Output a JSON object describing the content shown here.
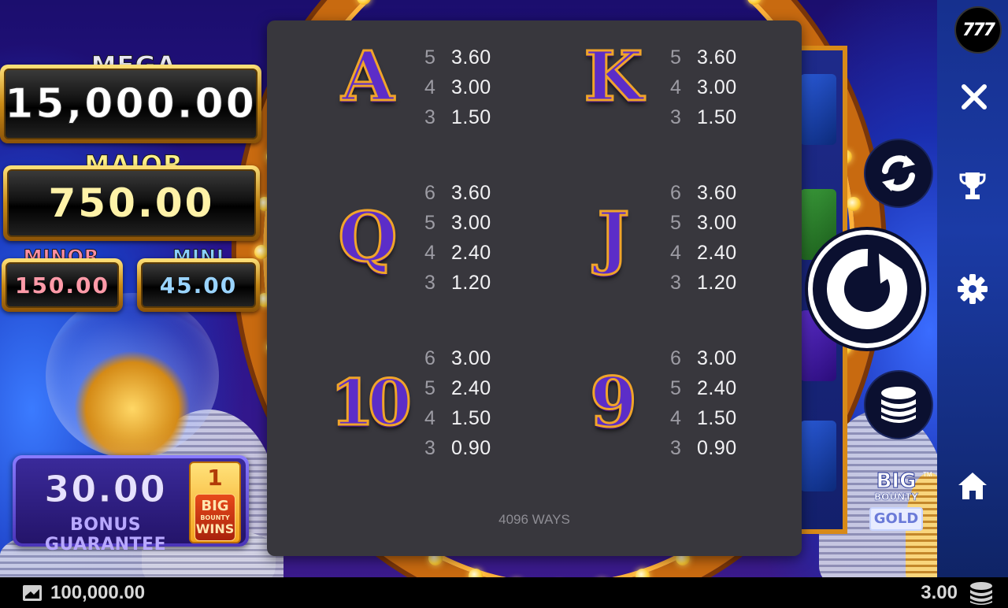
{
  "jackpots": {
    "mega": {
      "label": "MEGA",
      "value": "15,000.00"
    },
    "major": {
      "label": "MAJOR",
      "value": "750.00"
    },
    "minor": {
      "label": "MINOR",
      "value": "150.00"
    },
    "mini": {
      "label": "MINI",
      "value": "45.00"
    }
  },
  "bonus_guarantee": {
    "value": "30.00",
    "label": "BONUS GUARANTEE",
    "badge_count": "1",
    "badge_logo": [
      "BIG",
      "BOUNTY",
      "WINS"
    ]
  },
  "paytable": {
    "symbols": [
      {
        "glyph": "A",
        "pays": [
          {
            "count": "5",
            "value": "3.60"
          },
          {
            "count": "4",
            "value": "3.00"
          },
          {
            "count": "3",
            "value": "1.50"
          }
        ]
      },
      {
        "glyph": "K",
        "pays": [
          {
            "count": "5",
            "value": "3.60"
          },
          {
            "count": "4",
            "value": "3.00"
          },
          {
            "count": "3",
            "value": "1.50"
          }
        ]
      },
      {
        "glyph": "Q",
        "pays": [
          {
            "count": "6",
            "value": "3.60"
          },
          {
            "count": "5",
            "value": "3.00"
          },
          {
            "count": "4",
            "value": "2.40"
          },
          {
            "count": "3",
            "value": "1.20"
          }
        ]
      },
      {
        "glyph": "J",
        "pays": [
          {
            "count": "6",
            "value": "3.60"
          },
          {
            "count": "5",
            "value": "3.00"
          },
          {
            "count": "4",
            "value": "2.40"
          },
          {
            "count": "3",
            "value": "1.20"
          }
        ]
      },
      {
        "glyph": "10",
        "pays": [
          {
            "count": "6",
            "value": "3.00"
          },
          {
            "count": "5",
            "value": "2.40"
          },
          {
            "count": "4",
            "value": "1.50"
          },
          {
            "count": "3",
            "value": "0.90"
          }
        ]
      },
      {
        "glyph": "9",
        "pays": [
          {
            "count": "6",
            "value": "3.00"
          },
          {
            "count": "5",
            "value": "2.40"
          },
          {
            "count": "4",
            "value": "1.50"
          },
          {
            "count": "3",
            "value": "0.90"
          }
        ]
      }
    ],
    "ways_text": "4096 WAYS"
  },
  "sidebar": {
    "logo": "777",
    "icons": [
      "close-icon",
      "trophy-icon",
      "settings-icon",
      "home-icon"
    ]
  },
  "controls": {
    "autoplay_icon": "autoplay-icon",
    "spin_icon": "spin-icon",
    "bet_icon": "coin-stack-icon"
  },
  "game_logo": {
    "line1": "BIG",
    "line2": "BOUNTY",
    "line3": "GOLD",
    "tm": "TM"
  },
  "footer": {
    "balance": "100,000.00",
    "bet": "3.00"
  },
  "colors": {
    "modal_bg": "#38373d",
    "pay_value": "#f2f2f4",
    "pay_count": "#9d9ca4",
    "symbol_fill": "#5c2dc8",
    "symbol_outline": "#f0a42a",
    "mega_text": "#ffffff",
    "major_text": "#fff2a8",
    "minor_text": "#ff9aa8",
    "mini_text": "#9ad4ff"
  }
}
